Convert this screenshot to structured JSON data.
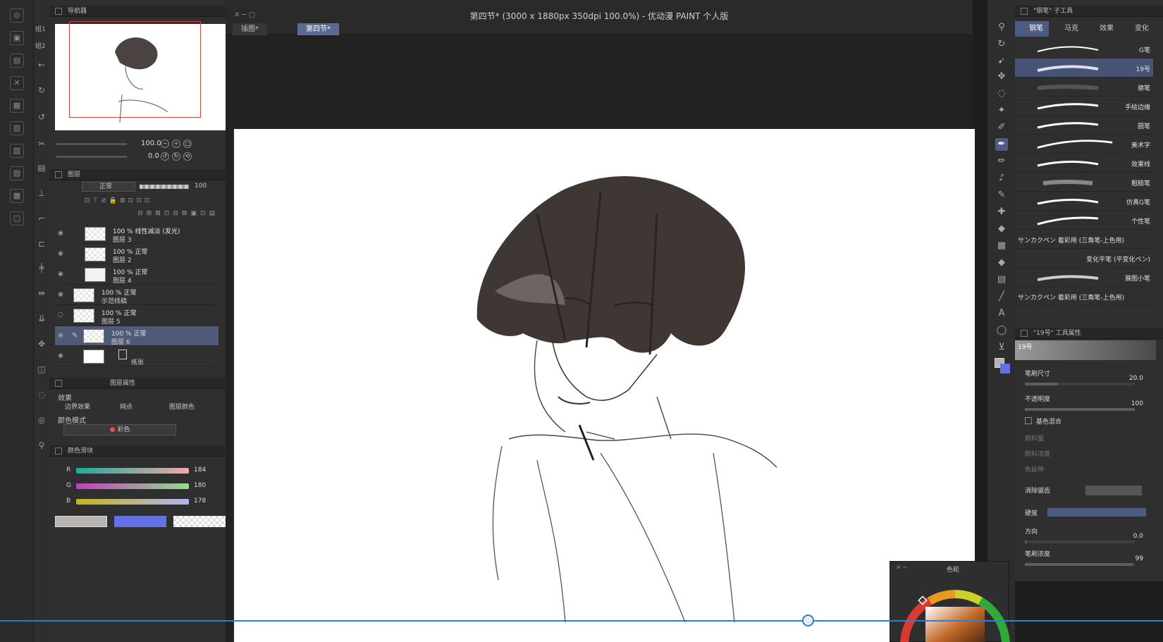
{
  "document": {
    "title": "第四节* (3000 x 1880px 350dpi 100.0%) - 优动漫 PAINT 个人版",
    "tabs": [
      "插图*",
      "第四节*"
    ],
    "active_tab": 1
  },
  "navigator": {
    "header": "导航器",
    "zoom": "100.0",
    "rotate": "0.0"
  },
  "left_col2": {
    "labels": [
      "组1",
      "组2"
    ]
  },
  "layers": {
    "header": "图层",
    "blend_mode": "正常",
    "opacity": "100",
    "items": [
      {
        "line1": "100 % 线性减淡 (发光)",
        "line2": "图层 3",
        "selected": false
      },
      {
        "line1": "100 % 正常",
        "line2": "图层 2",
        "selected": false
      },
      {
        "line1": "100 % 正常",
        "line2": "图层 4",
        "selected": false
      },
      {
        "line1": "100 % 正常",
        "line2": "示范线稿",
        "selected": false
      },
      {
        "line1": "100 % 正常",
        "line2": "图层 5",
        "selected": false
      },
      {
        "line1": "100 % 正常",
        "line2": "图层 6",
        "selected": true
      },
      {
        "line1": "",
        "line2": "纸张",
        "selected": false
      }
    ]
  },
  "layer_property": {
    "header": "图层属性",
    "effect_label": "效果",
    "effects": [
      "边界效果",
      "网点",
      "图层颜色"
    ],
    "color_mode_label": "颜色模式",
    "color_mode_value": "彩色"
  },
  "color_slider": {
    "header": "颜色滑块",
    "rows": [
      {
        "label": "R",
        "value": "184"
      },
      {
        "label": "G",
        "value": "180"
      },
      {
        "label": "B",
        "value": "178"
      }
    ],
    "colors": {
      "main": "#b8b4b2",
      "sub": "#6470e6"
    }
  },
  "sub_tool": {
    "header": "\"钢笔\" 子工具",
    "tabs": [
      "钢笔",
      "马克",
      "效果",
      "变化"
    ],
    "brushes": [
      {
        "name": "G笔",
        "selected": false
      },
      {
        "name": "19号",
        "selected": true
      },
      {
        "name": "德笔",
        "selected": false
      },
      {
        "name": "手绘边缘",
        "selected": false
      },
      {
        "name": "圆笔",
        "selected": false
      },
      {
        "name": "美术字",
        "selected": false
      },
      {
        "name": "效果线",
        "selected": false
      },
      {
        "name": "粗糙笔",
        "selected": false
      },
      {
        "name": "仿真G笔",
        "selected": false
      },
      {
        "name": "个性笔",
        "selected": false
      },
      {
        "name": "サンカクペン 着彩用 (三角笔-上色用)",
        "selected": false
      },
      {
        "name": "变化平笔 (平变化ペン)",
        "selected": false
      },
      {
        "name": "展图小笔",
        "selected": false
      },
      {
        "name": "サンカクペン 着彩用 (三角笔-上色用)",
        "selected": false
      }
    ]
  },
  "tool_property": {
    "header": "\"19号\" 工具属性",
    "preview_label": "19号",
    "props": [
      {
        "label": "笔刷尺寸",
        "value": "20.0",
        "fill": 0.3
      },
      {
        "label": "不透明度",
        "value": "100",
        "fill": 1.0
      },
      {
        "label": "基色混合",
        "value": "",
        "fill": 0
      },
      {
        "label": "颜料量",
        "value": "",
        "fill": 0
      },
      {
        "label": "颜料浓度",
        "value": "",
        "fill": 0
      },
      {
        "label": "色延伸",
        "value": "",
        "fill": 0
      },
      {
        "label": "消除锯齿",
        "value": "",
        "fill": 0
      },
      {
        "label": "硬度",
        "value": "",
        "fill": 0
      },
      {
        "label": "方向",
        "value": "0.0",
        "fill": 0.02
      },
      {
        "label": "笔刷浓度",
        "value": "99",
        "fill": 0.98
      }
    ]
  },
  "color_wheel": {
    "header": "色轮"
  },
  "timeline": {
    "progress": 0.69
  }
}
